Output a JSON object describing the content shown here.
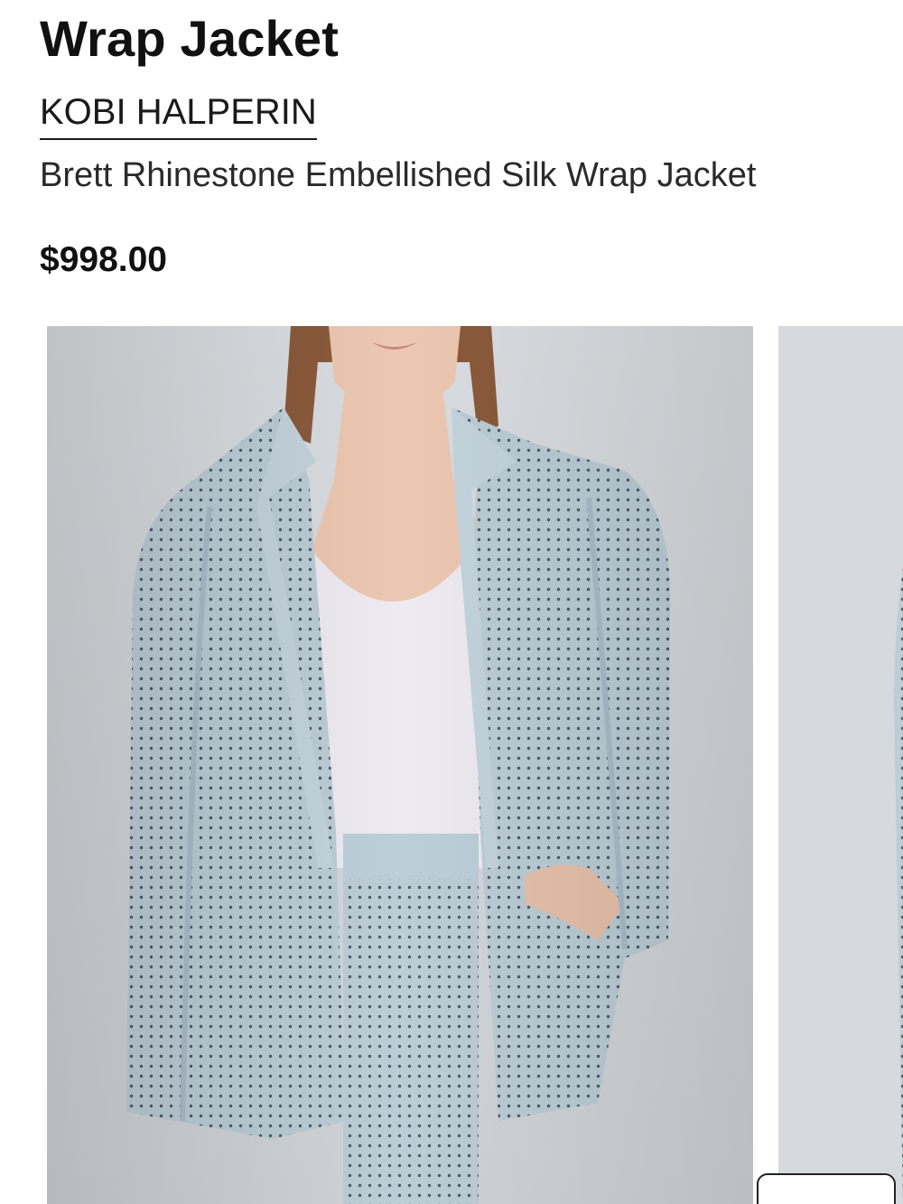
{
  "product": {
    "title": "Wrap Jacket",
    "brand": "KOBI HALPERIN",
    "name": "Brett Rhinestone Embellished Silk Wrap Jacket",
    "price": "$998.00"
  },
  "gallery": {
    "images": [
      {
        "label": "product-photo-front"
      },
      {
        "label": "product-photo-next"
      }
    ]
  },
  "colors": {
    "background": "#ffffff",
    "text": "#111111",
    "jacket": "#b9ccd6",
    "backdrop": "#d9dce0"
  }
}
